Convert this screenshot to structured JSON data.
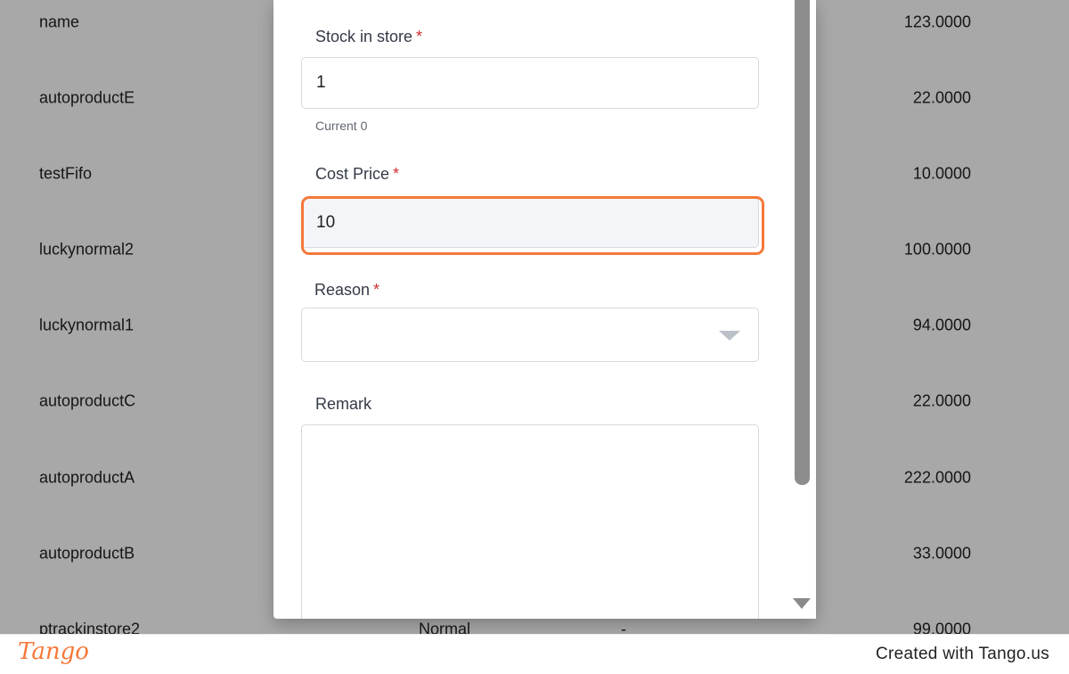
{
  "background_list": {
    "rows": [
      {
        "name": "name",
        "value": "123.0000"
      },
      {
        "name": "autoproductE",
        "value": "22.0000"
      },
      {
        "name": "testFifo",
        "value": "10.0000"
      },
      {
        "name": "luckynormal2",
        "value": "100.0000"
      },
      {
        "name": "luckynormal1",
        "value": "94.0000"
      },
      {
        "name": "autoproductC",
        "value": "22.0000"
      },
      {
        "name": "autoproductA",
        "value": "222.0000"
      },
      {
        "name": "autoproductB",
        "value": "33.0000"
      },
      {
        "name": "ptrackinstore2",
        "type": "Normal",
        "dash": "-",
        "value": "99.0000"
      }
    ]
  },
  "modal": {
    "stock": {
      "label": "Stock in store",
      "required": "*",
      "value": "1",
      "hint": "Current 0"
    },
    "cost_price": {
      "label": "Cost Price",
      "required": "*",
      "value": "10"
    },
    "reason": {
      "label": "Reason",
      "required": "*",
      "value": "",
      "icon": "chevron-down-icon"
    },
    "remark": {
      "label": "Remark",
      "value": ""
    }
  },
  "footer": {
    "logo": "Tango",
    "credit": "Created with Tango.us"
  },
  "colors": {
    "highlight": "#f5793b",
    "required": "#d32f2f",
    "overlay": "rgba(0,0,0,0.34)"
  }
}
